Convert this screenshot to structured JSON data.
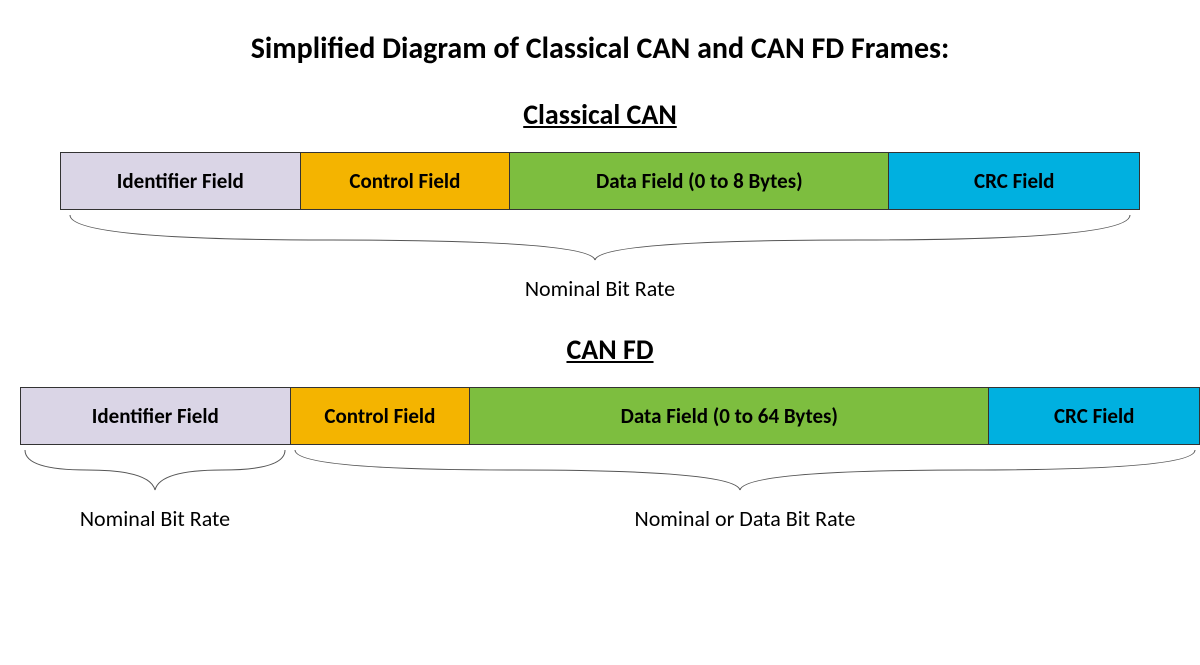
{
  "title": "Simplified Diagram of Classical CAN and CAN FD Frames:",
  "classical": {
    "sectionTitle": "Classical CAN",
    "fields": {
      "identifier": "Identifier Field",
      "control": "Control Field",
      "data": "Data Field (0 to 8 Bytes)",
      "crc": "CRC Field"
    },
    "rateLabel": "Nominal Bit Rate"
  },
  "canfd": {
    "sectionTitle": "CAN FD",
    "fields": {
      "identifier": "Identifier Field",
      "control": "Control Field",
      "data": "Data Field (0 to 64 Bytes)",
      "crc": "CRC Field"
    },
    "rateLabel1": "Nominal Bit Rate",
    "rateLabel2": "Nominal or Data Bit Rate"
  },
  "colors": {
    "identifier": "#dad5e6",
    "control": "#f4b400",
    "data": "#7dbe3f",
    "crc": "#00b0e0"
  }
}
